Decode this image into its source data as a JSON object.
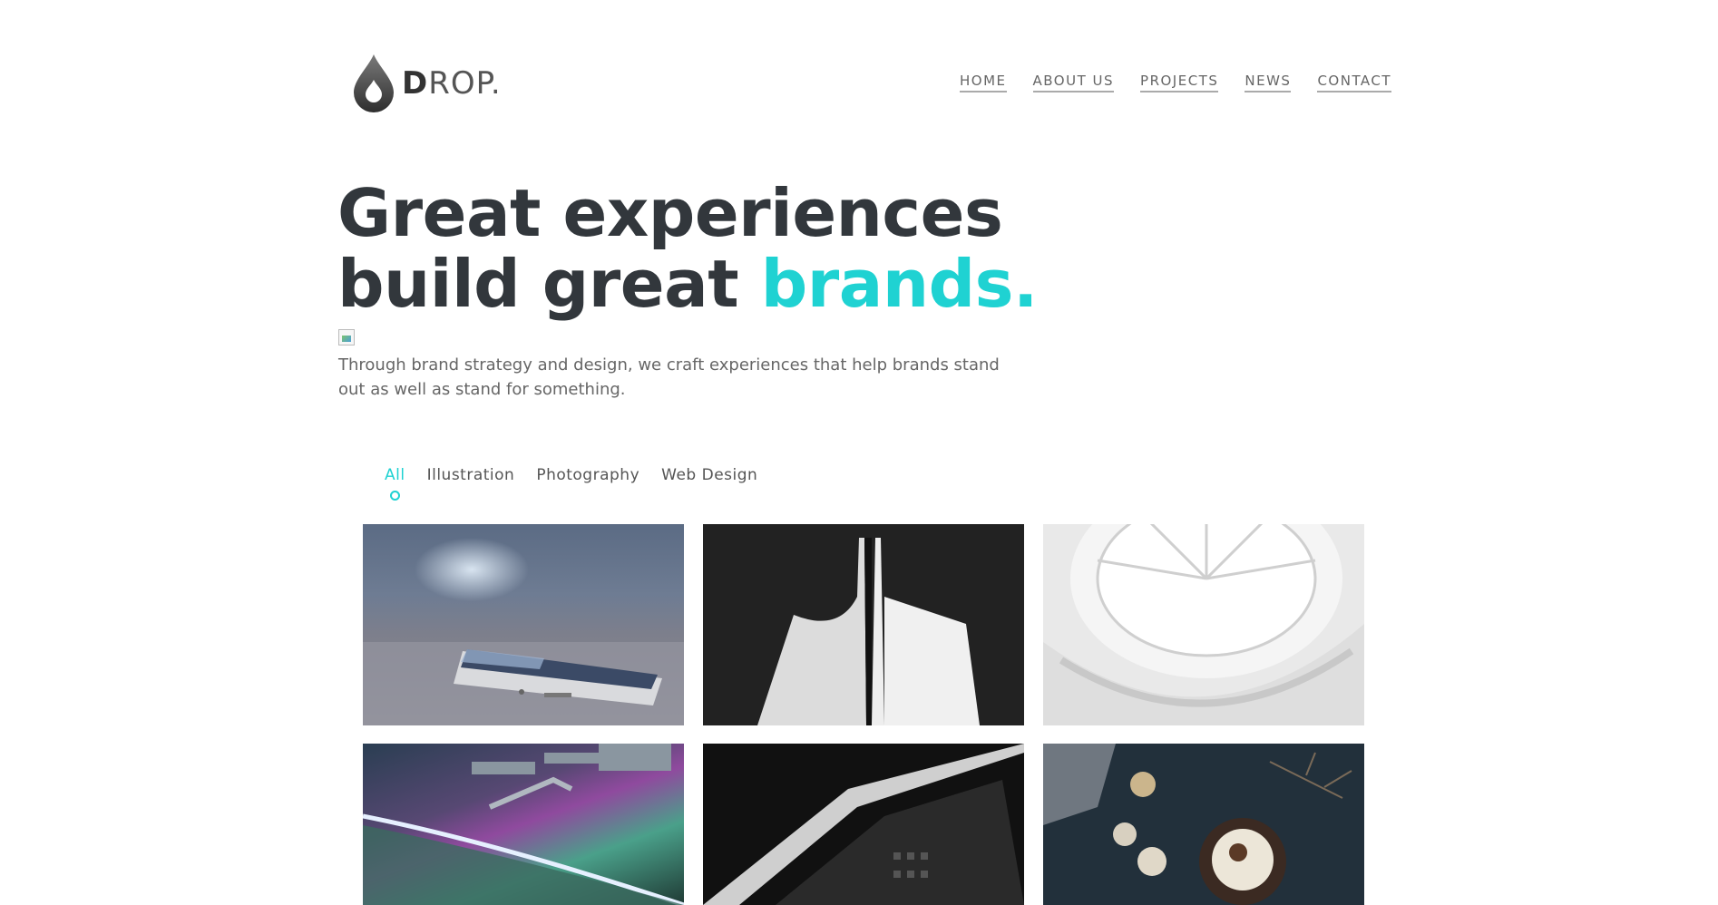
{
  "brand": {
    "logo_icon": "water-drop-icon",
    "name_bold": "D",
    "name_rest": "ROP."
  },
  "nav": {
    "items": [
      {
        "label": "HOME"
      },
      {
        "label": "ABOUT US"
      },
      {
        "label": "PROJECTS"
      },
      {
        "label": "NEWS"
      },
      {
        "label": "CONTACT"
      }
    ]
  },
  "hero": {
    "title_line1": "Great experiences",
    "title_line2_plain": "build great ",
    "title_line2_accent": "brands.",
    "subtitle": "Through brand strategy and design, we craft experiences that help brands stand out as well as stand for something.",
    "accent_color": "#1fd2d2"
  },
  "filters": {
    "items": [
      {
        "label": "All",
        "active": true
      },
      {
        "label": "Illustration",
        "active": false
      },
      {
        "label": "Photography",
        "active": false
      },
      {
        "label": "Web Design",
        "active": false
      }
    ]
  },
  "portfolio": {
    "tiles": [
      {
        "subject": "smartphone-on-table"
      },
      {
        "subject": "white-building-black-sky"
      },
      {
        "subject": "spiral-atrium-skylight"
      },
      {
        "subject": "space-station-aurora"
      },
      {
        "subject": "dark-building-angles"
      },
      {
        "subject": "food-on-dark-table"
      }
    ]
  }
}
